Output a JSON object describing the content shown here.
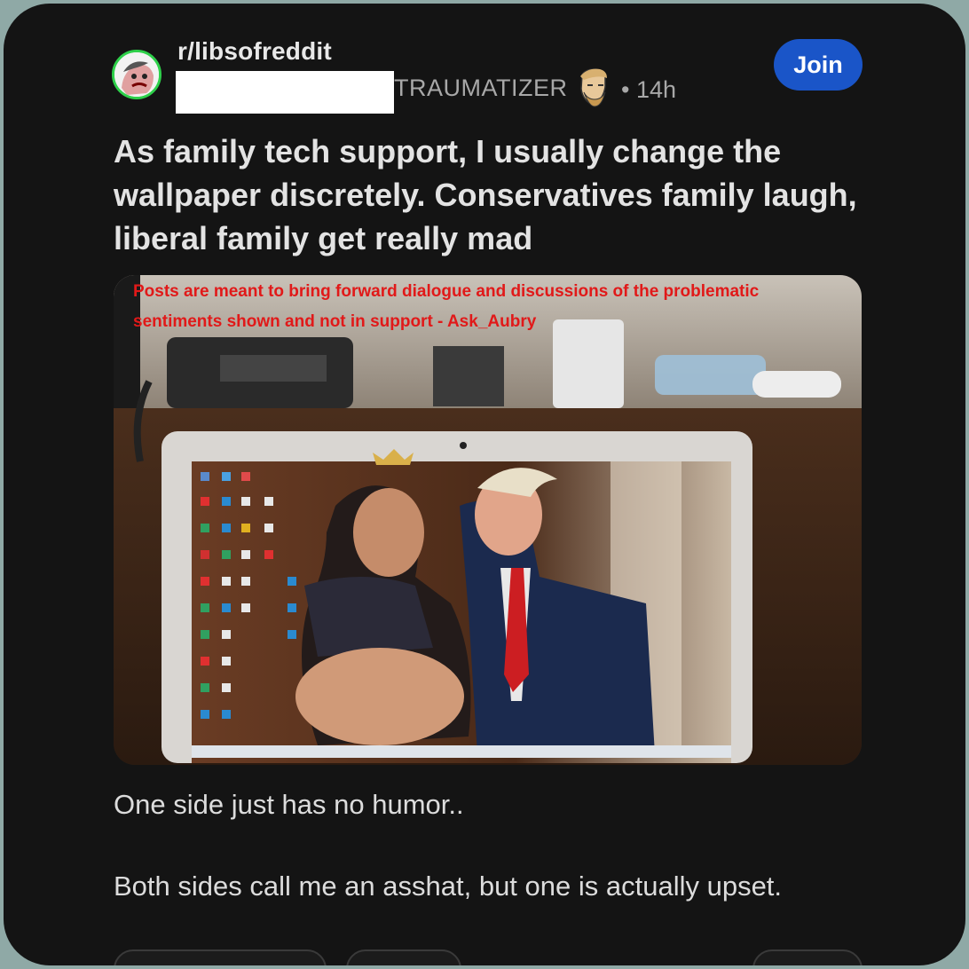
{
  "post": {
    "subreddit": "r/libsofreddit",
    "username_suffix": "TRAUMATIZER",
    "separator": "•",
    "time": "14h",
    "join_label": "Join",
    "title": "As family tech support, I usually change the wallpaper discretely. Conservatives family laugh, liberal family get really mad",
    "mod_note": "Posts are meant to bring forward dialogue and discussions of the problematic sentiments shown and not in support - Ask_Aubry",
    "body": [
      "One side just has no humor..",
      "Both sides call me an asshat,  but one is actually upset."
    ]
  },
  "icons": {
    "avatar": "subreddit-avatar-icon",
    "flair": "chad-face-flair-icon"
  },
  "colors": {
    "background": "#141414",
    "join_button": "#1a55c8",
    "mod_note": "#e11919",
    "avatar_ring": "#2ed04a",
    "frame": "#8fa9a6"
  }
}
